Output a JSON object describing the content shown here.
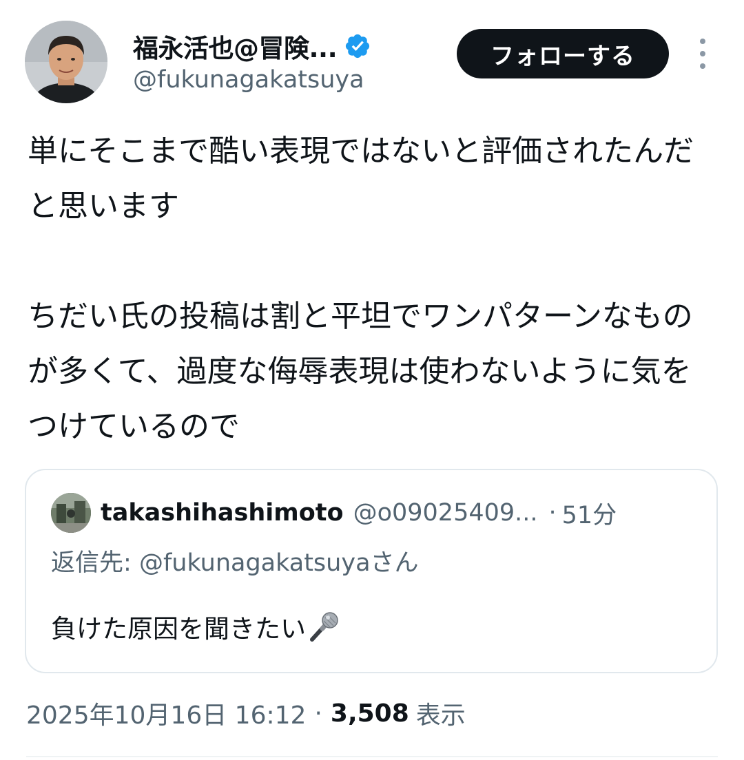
{
  "author": {
    "display_name": "福永活也@冒険...",
    "handle": "@fukunagakatsuya",
    "verified": true
  },
  "follow_button_label": "フォローする",
  "tweet": {
    "paragraphs": [
      "単にそこまで酷い表現ではないと評価されたんだと思います",
      "ちだい氏の投稿は割と平坦でワンパターンなものが多くて、過度な侮辱表現は使わないように気をつけているので"
    ]
  },
  "quoted_tweet": {
    "display_name": "takashihashimoto",
    "handle": "@o09025409...",
    "separator": "·",
    "time": "51分",
    "reply_prefix": "返信先:",
    "reply_handle": "@fukunagakatsuyaさん",
    "text": "負けた原因を聞きたい",
    "emoji_icon": "microphone-icon"
  },
  "meta": {
    "timestamp": "2025年10月16日 16:12",
    "separator": "·",
    "views_count": "3,508",
    "views_label": "表示"
  },
  "colors": {
    "text_primary": "#0f1419",
    "text_secondary": "#536471",
    "verified_blue": "#1d9bf0",
    "border": "#e1e8ed",
    "button_bg": "#0f1419"
  }
}
